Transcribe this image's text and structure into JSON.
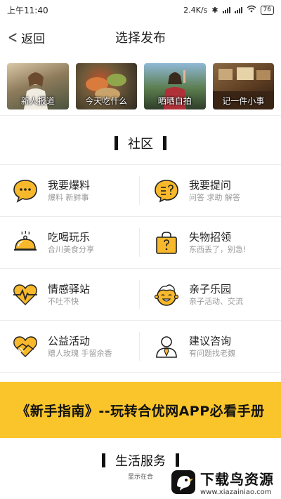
{
  "status_bar": {
    "time": "上午11:40",
    "network_speed": "2.4K/s",
    "battery": "76"
  },
  "header": {
    "back_label": "返回",
    "title": "选择发布"
  },
  "banners": [
    {
      "label": "新人报道"
    },
    {
      "label": "今天吃什么"
    },
    {
      "label": "晒晒自拍"
    },
    {
      "label": "记一件小事"
    }
  ],
  "community": {
    "title": "社区",
    "items": [
      {
        "name": "我要爆料",
        "sub": "爆料 新鲜事",
        "icon": "chat-bubble-icon"
      },
      {
        "name": "我要提问",
        "sub": "问答 求助 解答",
        "icon": "question-bubble-icon"
      },
      {
        "name": "吃喝玩乐",
        "sub": "合川美食分享",
        "icon": "food-cloche-icon"
      },
      {
        "name": "失物招领",
        "sub": "东西丢了，别急!",
        "icon": "lost-bag-icon"
      },
      {
        "name": "情感驿站",
        "sub": "不吐不快",
        "icon": "heartbeat-icon"
      },
      {
        "name": "亲子乐园",
        "sub": "亲子活动、交流",
        "icon": "child-face-icon"
      },
      {
        "name": "公益活动",
        "sub": "赠人玫瑰 手留余香",
        "icon": "heart-hands-icon"
      },
      {
        "name": "建议咨询",
        "sub": "有问题找老魏",
        "icon": "person-tie-icon"
      }
    ]
  },
  "promo_banner": {
    "text": "《新手指南》--玩转合优网APP必看手册"
  },
  "life_services": {
    "title": "生活服务",
    "subtitle": "显示在合"
  },
  "watermark": {
    "title": "下载鸟资源",
    "url": "www.xiazainiao.com"
  },
  "colors": {
    "accent_yellow": "#f9c52b",
    "icon_yellow": "#f7b82b"
  }
}
